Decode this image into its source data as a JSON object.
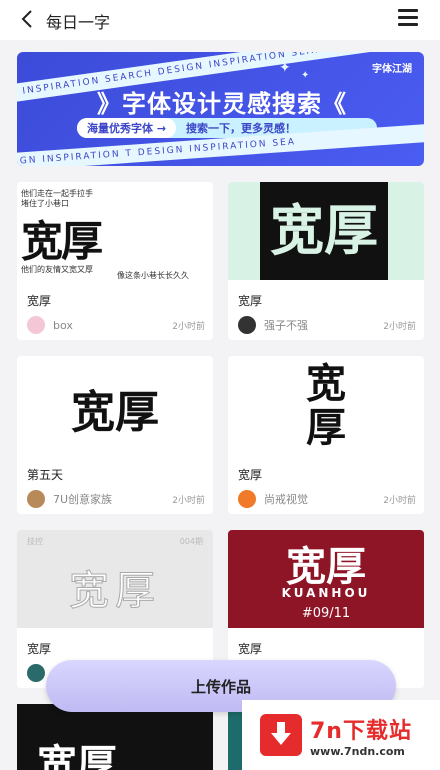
{
  "header": {
    "title": "每日一字"
  },
  "banner": {
    "brand": "字体江湖",
    "headline": "》字体设计灵感搜索《",
    "pill_left": "海量优秀字体 →",
    "pill_right": "搜索一下，更多灵感！",
    "stripe_text": "N INSPIRATION SEARCH DESIGN INSPIRATION SEARCH",
    "stripe_text_2": "SIGN INSPIRATION  T DESIGN INSPIRATION SEA"
  },
  "cards": [
    {
      "title": "宽厚",
      "author": "box",
      "time": "2小时前",
      "avatar_color": "#f4c7d6",
      "art": {
        "line1": "他们走在一起手拉手",
        "line2": "堵住了小巷口",
        "line3": "他们的友情又宽又厚",
        "line4": "像这条小巷长长久久",
        "big": "宽厚"
      }
    },
    {
      "title": "宽厚",
      "author": "强子不强",
      "time": "2小时前",
      "avatar_color": "#333333",
      "art": {
        "big": "宽厚"
      }
    },
    {
      "title": "第五天",
      "author": "7U创意家族",
      "time": "2小时前",
      "avatar_color": "#b88a5a",
      "art": {
        "big": "宽厚"
      }
    },
    {
      "title": "宽厚",
      "author": "尚戒视觉",
      "time": "2小时前",
      "avatar_color": "#f07a2a",
      "art": {
        "big": "宽\n厚"
      }
    },
    {
      "title": "宽厚",
      "author": "",
      "time": "",
      "avatar_color": "#2a6a6a",
      "art": {
        "big": "宽厚",
        "small_tl": "技控",
        "small_tr": "004期"
      }
    },
    {
      "title": "宽厚",
      "author": "",
      "time": "",
      "avatar_color": "#cccccc",
      "art": {
        "big": "宽厚",
        "sub": "KUANHOU",
        "num": "#09/11"
      }
    }
  ],
  "bottom_card": {
    "big": "宽厚"
  },
  "upload_button": {
    "label": "上传作品"
  },
  "watermark": {
    "name": "7n下载站",
    "url": "www.7ndn.com"
  },
  "colors": {
    "accent": "#4b5cf2",
    "card_red": "#8e1525",
    "watermark_red": "#e52b2b"
  }
}
